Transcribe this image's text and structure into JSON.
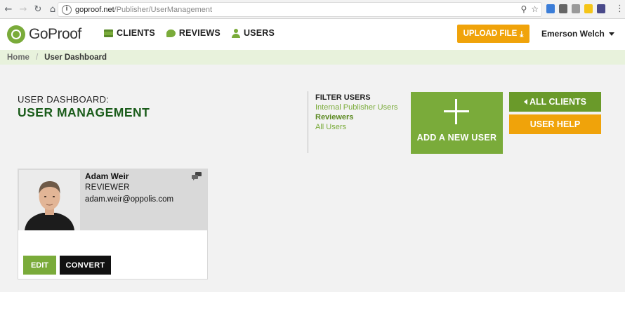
{
  "browser": {
    "url_host": "goproof.net",
    "url_path": "/Publisher/UserManagement",
    "back_icon": "←",
    "forward_icon": "→",
    "reload_icon": "↻",
    "home_icon": "⌂",
    "zoom_icon": "⚲",
    "star_icon": "☆",
    "menu_icon": "⋮"
  },
  "header": {
    "logo_text": "GoProof",
    "nav": [
      {
        "label": "CLIENTS",
        "icon": "folder-stack-icon"
      },
      {
        "label": "REVIEWS",
        "icon": "speech-bubble-icon"
      },
      {
        "label": "USERS",
        "icon": "user-icon"
      }
    ],
    "upload_label": "UPLOAD FILE",
    "upload_icon": "⤓",
    "user_name": "Emerson Welch"
  },
  "breadcrumb": {
    "home": "Home",
    "separator": "/",
    "current": "User Dashboard"
  },
  "page": {
    "subtitle": "USER DASHBOARD:",
    "title": "USER MANAGEMENT"
  },
  "filter": {
    "title": "FILTER USERS",
    "options": [
      "Internal Publisher Users",
      "Reviewers",
      "All Users"
    ],
    "active": "Reviewers"
  },
  "actions": {
    "add_user": "ADD A NEW USER",
    "all_clients": "ALL CLIENTS",
    "user_help": "USER HELP"
  },
  "users": [
    {
      "name": "Adam Weir",
      "role": "REVIEWER",
      "email": "adam.weir@oppolis.com",
      "edit_label": "EDIT",
      "convert_label": "CONVERT"
    }
  ],
  "colors": {
    "brand_green": "#7aab3a",
    "dark_green": "#1a5c1a",
    "orange": "#f0a30a",
    "breadcrumb_bg": "#e8f2dc"
  }
}
